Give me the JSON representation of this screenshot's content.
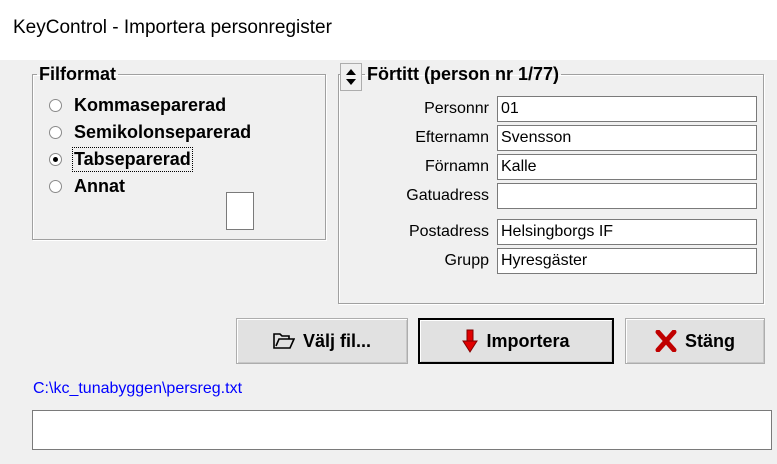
{
  "window": {
    "title": "KeyControl - Importera personregister"
  },
  "file_format": {
    "legend": "Filformat",
    "options": [
      {
        "label": "Kommaseparerad",
        "checked": false
      },
      {
        "label": "Semikolonseparerad",
        "checked": false
      },
      {
        "label": "Tabseparerad",
        "checked": true
      },
      {
        "label": "Annat",
        "checked": false
      }
    ],
    "other_value": ""
  },
  "preview": {
    "legend": "Förtitt (person nr 1/77)",
    "fields": [
      {
        "label": "Personnr",
        "value": "01"
      },
      {
        "label": "Efternamn",
        "value": "Svensson"
      },
      {
        "label": "Förnamn",
        "value": "Kalle"
      },
      {
        "label": "Gatuadress",
        "value": ""
      },
      {
        "label": "Postadress",
        "value": "Helsingborgs IF"
      },
      {
        "label": "Grupp",
        "value": "Hyresgäster"
      }
    ]
  },
  "buttons": {
    "select_file": "Välj fil...",
    "import": "Importera",
    "close": "Stäng"
  },
  "icons": {
    "select_file": "folder-icon",
    "import": "down-arrow-icon",
    "close": "x-icon",
    "import_color": "#e00000",
    "close_color": "#c00000"
  },
  "file_path": "C:\\kc_tunabyggen\\persreg.txt",
  "status_text": ""
}
